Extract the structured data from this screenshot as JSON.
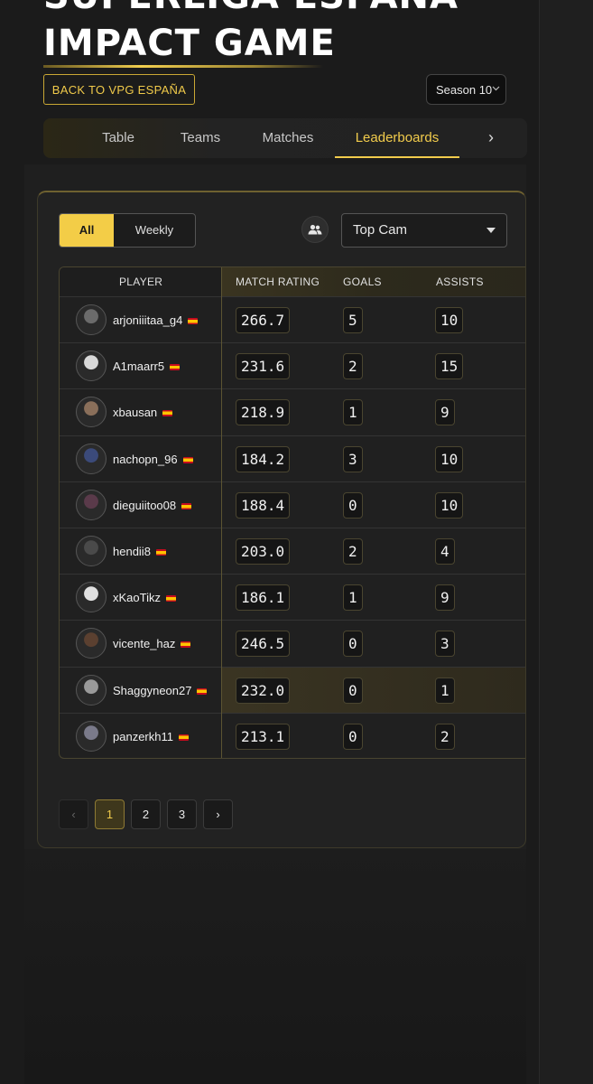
{
  "header": {
    "title_partial": "SUPERLIGA ESPAÑA",
    "title": "IMPACT GAME",
    "back_label": "BACK TO VPG ESPAÑA",
    "season": "Season 10"
  },
  "tabs": [
    {
      "label": "Table"
    },
    {
      "label": "Teams"
    },
    {
      "label": "Matches"
    },
    {
      "label": "Leaderboards",
      "active": true
    }
  ],
  "filters": {
    "all_label": "All",
    "weekly_label": "Weekly",
    "position": "Top Cam"
  },
  "table": {
    "headers": {
      "player": "PLAYER",
      "rating": "MATCH RATING",
      "goals": "GOALS",
      "assists": "ASSISTS"
    },
    "rows": [
      {
        "player": "arjoniiitaa_g4",
        "rating": "266.7",
        "goals": "5",
        "assists": "10"
      },
      {
        "player": "A1maarr5",
        "rating": "231.6",
        "goals": "2",
        "assists": "15"
      },
      {
        "player": "xbausan",
        "rating": "218.9",
        "goals": "1",
        "assists": "9"
      },
      {
        "player": "nachopn_96",
        "rating": "184.2",
        "goals": "3",
        "assists": "10"
      },
      {
        "player": "dieguiitoo08",
        "rating": "188.4",
        "goals": "0",
        "assists": "10"
      },
      {
        "player": "hendii8",
        "rating": "203.0",
        "goals": "2",
        "assists": "4"
      },
      {
        "player": "xKaoTikz",
        "rating": "186.1",
        "goals": "1",
        "assists": "9"
      },
      {
        "player": "vicente_haz",
        "rating": "246.5",
        "goals": "0",
        "assists": "3"
      },
      {
        "player": "Shaggyneon27",
        "rating": "232.0",
        "goals": "0",
        "assists": "1"
      },
      {
        "player": "panzerkh11",
        "rating": "213.1",
        "goals": "0",
        "assists": "2"
      }
    ]
  },
  "pagination": {
    "prev": "‹",
    "pages": [
      "1",
      "2",
      "3"
    ],
    "current": "1",
    "next": "›"
  },
  "colors": {
    "accent": "#f2cc4c",
    "background": "#1b1b1b",
    "card": "#222222"
  }
}
